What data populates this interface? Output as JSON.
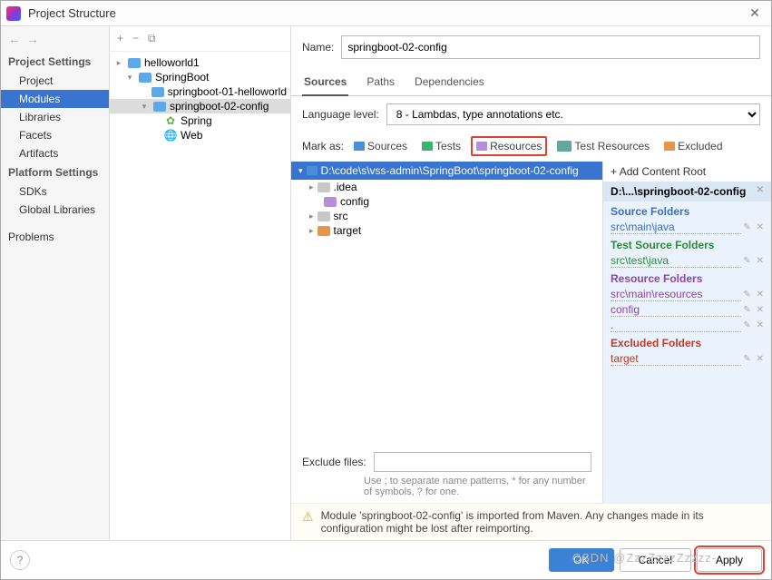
{
  "window": {
    "title": "Project Structure"
  },
  "sidebar": {
    "headings": {
      "project": "Project Settings",
      "platform": "Platform Settings"
    },
    "project_items": [
      "Project",
      "Modules",
      "Libraries",
      "Facets",
      "Artifacts"
    ],
    "platform_items": [
      "SDKs",
      "Global Libraries"
    ],
    "problems": "Problems"
  },
  "module_tree": {
    "root": {
      "name": "helloworld1"
    },
    "children": [
      {
        "name": "SpringBoot",
        "children": [
          {
            "name": "springboot-01-helloworld"
          },
          {
            "name": "springboot-02-config",
            "selected": true,
            "children": [
              {
                "name": "Spring",
                "icon": "spring"
              },
              {
                "name": "Web",
                "icon": "web"
              }
            ]
          }
        ]
      }
    ]
  },
  "form": {
    "name_label": "Name:",
    "name_value": "springboot-02-config",
    "tabs": [
      "Sources",
      "Paths",
      "Dependencies"
    ],
    "lang_label": "Language level:",
    "lang_value": "8 - Lambdas, type annotations etc."
  },
  "markas": {
    "label": "Mark as:",
    "items": [
      {
        "label": "Sources",
        "color": "blue",
        "key": "S"
      },
      {
        "label": "Tests",
        "color": "green",
        "key": "T"
      },
      {
        "label": "Resources",
        "color": "purple",
        "highlight": true
      },
      {
        "label": "Test Resources",
        "color": "teal"
      },
      {
        "label": "Excluded",
        "color": "orange"
      }
    ]
  },
  "content_root": {
    "path": "D:\\code\\s\\vss-admin\\SpringBoot\\springboot-02-config",
    "dirs": [
      {
        "name": ".idea",
        "color": "gray"
      },
      {
        "name": "config",
        "color": "purple"
      },
      {
        "name": "src",
        "color": "gray"
      },
      {
        "name": "target",
        "color": "orange"
      }
    ]
  },
  "right": {
    "add_root": "Add Content Root",
    "root_display": "D:\\...\\springboot-02-config",
    "sections": [
      {
        "title": "Source Folders",
        "cls": "c-src",
        "items": [
          "src\\main\\java"
        ]
      },
      {
        "title": "Test Source Folders",
        "cls": "c-test",
        "items": [
          "src\\test\\java"
        ]
      },
      {
        "title": "Resource Folders",
        "cls": "c-res",
        "items": [
          "src\\main\\resources",
          "config",
          "."
        ]
      },
      {
        "title": "Excluded Folders",
        "cls": "c-excl",
        "items": [
          "target"
        ]
      }
    ]
  },
  "exclude": {
    "label": "Exclude files:",
    "hint": "Use ; to separate name patterns, * for any number of symbols, ? for one."
  },
  "warning": "Module 'springboot-02-config' is imported from Maven. Any changes made in its configuration might be lost after reimporting.",
  "buttons": {
    "ok": "OK",
    "cancel": "Cancel",
    "apply": "Apply"
  },
  "watermark": "CSDN @ZzzZzzzZzzzz-"
}
